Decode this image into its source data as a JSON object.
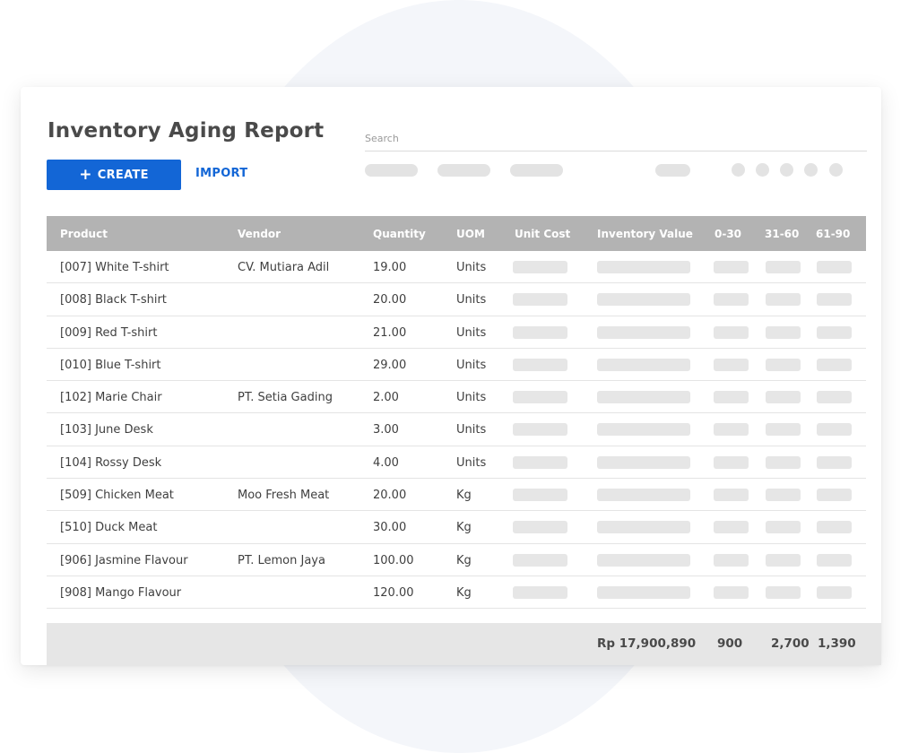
{
  "title": "Inventory Aging Report",
  "toolbar": {
    "create_label": "CREATE",
    "import_label": "IMPORT",
    "search_placeholder": "Search"
  },
  "colors": {
    "accent": "#1366d6",
    "header_bg": "#b3b3b3",
    "footer_bg": "#e6e6e6",
    "skeleton": "#e6e6e6"
  },
  "table": {
    "columns": [
      "Product",
      "Vendor",
      "Quantity",
      "UOM",
      "Unit Cost",
      "Inventory Value",
      "0-30",
      "31-60",
      "61-90"
    ],
    "rows": [
      {
        "product": "[007] White T-shirt",
        "vendor": "CV. Mutiara Adil",
        "quantity": "19.00",
        "uom": "Units"
      },
      {
        "product": "[008] Black T-shirt",
        "vendor": "",
        "quantity": "20.00",
        "uom": "Units"
      },
      {
        "product": "[009] Red T-shirt",
        "vendor": "",
        "quantity": "21.00",
        "uom": "Units"
      },
      {
        "product": "[010] Blue T-shirt",
        "vendor": "",
        "quantity": "29.00",
        "uom": "Units"
      },
      {
        "product": "[102] Marie Chair",
        "vendor": "PT. Setia Gading",
        "quantity": "2.00",
        "uom": "Units"
      },
      {
        "product": "[103] June Desk",
        "vendor": "",
        "quantity": "3.00",
        "uom": "Units"
      },
      {
        "product": "[104] Rossy Desk",
        "vendor": "",
        "quantity": "4.00",
        "uom": "Units"
      },
      {
        "product": "[509] Chicken Meat",
        "vendor": "Moo Fresh Meat",
        "quantity": "20.00",
        "uom": "Kg"
      },
      {
        "product": "[510] Duck Meat",
        "vendor": "",
        "quantity": "30.00",
        "uom": "Kg"
      },
      {
        "product": "[906] Jasmine Flavour",
        "vendor": "PT. Lemon Jaya",
        "quantity": "100.00",
        "uom": "Kg"
      },
      {
        "product": "[908] Mango Flavour",
        "vendor": "",
        "quantity": "120.00",
        "uom": "Kg"
      }
    ],
    "totals": {
      "inventory_value": "Rp 17,900,890",
      "age_0_30": "900",
      "age_31_60": "2,700",
      "age_61_90": "1,390"
    }
  }
}
